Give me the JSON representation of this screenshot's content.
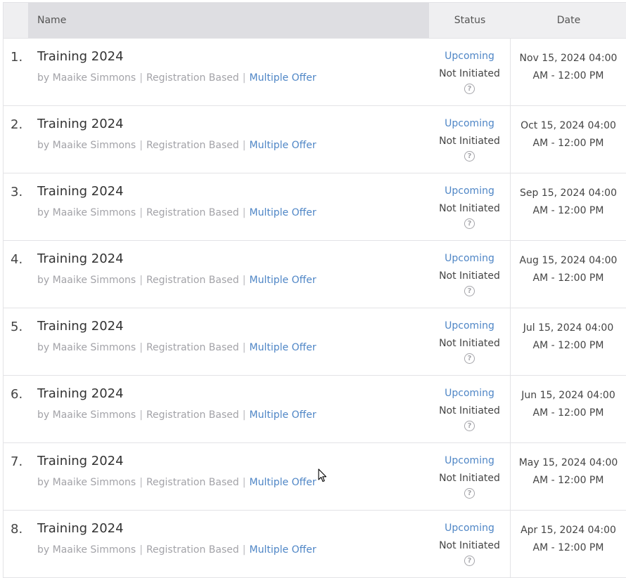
{
  "header": {
    "name": "Name",
    "status": "Status",
    "date": "Date"
  },
  "rows": [
    {
      "num": "1.",
      "title": "Training 2024",
      "by": "by Maaike Simmons",
      "type": "Registration Based",
      "offer": "Multiple Offer",
      "status": "Upcoming",
      "substatus": "Not Initiated",
      "date_line1": "Nov 15, 2024 04:00",
      "date_line2": "AM - 12:00 PM"
    },
    {
      "num": "2.",
      "title": "Training 2024",
      "by": "by Maaike Simmons",
      "type": "Registration Based",
      "offer": "Multiple Offer",
      "status": "Upcoming",
      "substatus": "Not Initiated",
      "date_line1": "Oct 15, 2024 04:00",
      "date_line2": "AM - 12:00 PM"
    },
    {
      "num": "3.",
      "title": "Training 2024",
      "by": "by Maaike Simmons",
      "type": "Registration Based",
      "offer": "Multiple Offer",
      "status": "Upcoming",
      "substatus": "Not Initiated",
      "date_line1": "Sep 15, 2024 04:00",
      "date_line2": "AM - 12:00 PM"
    },
    {
      "num": "4.",
      "title": "Training 2024",
      "by": "by Maaike Simmons",
      "type": "Registration Based",
      "offer": "Multiple Offer",
      "status": "Upcoming",
      "substatus": "Not Initiated",
      "date_line1": "Aug 15, 2024 04:00",
      "date_line2": "AM - 12:00 PM"
    },
    {
      "num": "5.",
      "title": "Training 2024",
      "by": "by Maaike Simmons",
      "type": "Registration Based",
      "offer": "Multiple Offer",
      "status": "Upcoming",
      "substatus": "Not Initiated",
      "date_line1": "Jul 15, 2024 04:00",
      "date_line2": "AM - 12:00 PM"
    },
    {
      "num": "6.",
      "title": "Training 2024",
      "by": "by Maaike Simmons",
      "type": "Registration Based",
      "offer": "Multiple Offer",
      "status": "Upcoming",
      "substatus": "Not Initiated",
      "date_line1": "Jun 15, 2024 04:00",
      "date_line2": "AM - 12:00 PM"
    },
    {
      "num": "7.",
      "title": "Training 2024",
      "by": "by Maaike Simmons",
      "type": "Registration Based",
      "offer": "Multiple Offer",
      "status": "Upcoming",
      "substatus": "Not Initiated",
      "date_line1": "May 15, 2024 04:00",
      "date_line2": "AM - 12:00 PM"
    },
    {
      "num": "8.",
      "title": "Training 2024",
      "by": "by Maaike Simmons",
      "type": "Registration Based",
      "offer": "Multiple Offer",
      "status": "Upcoming",
      "substatus": "Not Initiated",
      "date_line1": "Apr 15, 2024 04:00",
      "date_line2": "AM - 12:00 PM"
    }
  ],
  "icons": {
    "help": "question-circle-icon",
    "help_glyph": "?",
    "cursor": "mouse-pointer-icon"
  },
  "colors": {
    "link": "#4f86c6",
    "muted": "#a3a3a8",
    "header_bg": "#efeff1",
    "header_name_bg": "#dedee2"
  }
}
